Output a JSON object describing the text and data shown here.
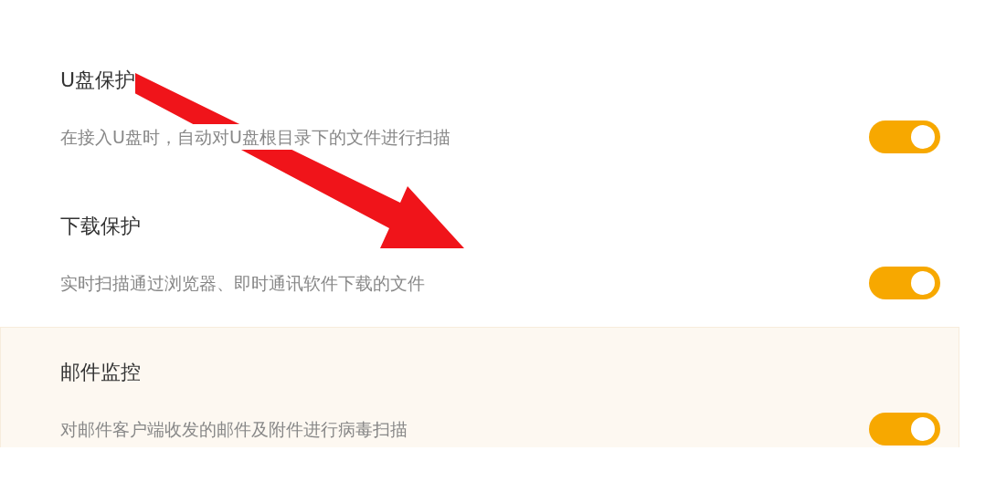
{
  "settings": [
    {
      "title": "U盘保护",
      "description": "在接入U盘时，自动对U盘根目录下的文件进行扫描",
      "on": true,
      "selected": false
    },
    {
      "title": "下载保护",
      "description": "实时扫描通过浏览器、即时通讯软件下载的文件",
      "on": true,
      "selected": false
    },
    {
      "title": "邮件监控",
      "description": "对邮件客户端收发的邮件及附件进行病毒扫描",
      "on": true,
      "selected": true
    }
  ]
}
